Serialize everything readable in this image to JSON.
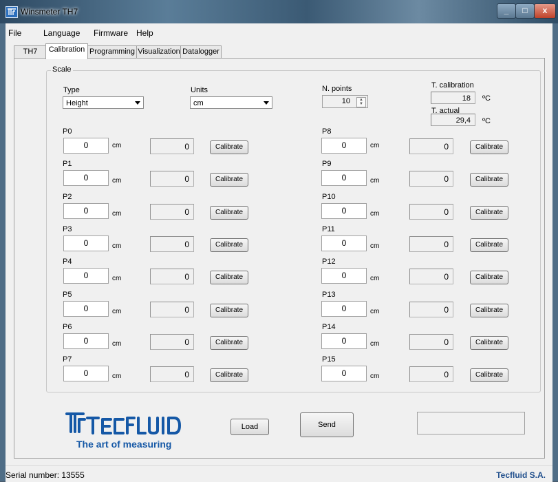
{
  "window": {
    "title": "Winsmeter TH7",
    "minimize": "_",
    "maximize": "□",
    "close": "x"
  },
  "menu": [
    "File",
    "Language",
    "Firmware",
    "Help"
  ],
  "tabs": [
    "TH7",
    "Calibration",
    "Programming",
    "Visualization",
    "Datalogger"
  ],
  "active_tab": "Calibration",
  "scale": {
    "group_label": "Scale",
    "type_label": "Type",
    "type_value": "Height",
    "units_label": "Units",
    "units_value": "cm",
    "npoints_label": "N. points",
    "npoints_value": "10",
    "tcal_label": "T. calibration",
    "tcal_value": "18",
    "tcal_unit": "ºC",
    "tact_label": "T. actual",
    "tact_value": "29,4",
    "tact_unit": "ºC"
  },
  "points": [
    {
      "label": "P0",
      "value": "0",
      "unit": "cm",
      "reading": "0",
      "button": "Calibrate"
    },
    {
      "label": "P1",
      "value": "0",
      "unit": "cm",
      "reading": "0",
      "button": "Calibrate"
    },
    {
      "label": "P2",
      "value": "0",
      "unit": "cm",
      "reading": "0",
      "button": "Calibrate"
    },
    {
      "label": "P3",
      "value": "0",
      "unit": "cm",
      "reading": "0",
      "button": "Calibrate"
    },
    {
      "label": "P4",
      "value": "0",
      "unit": "cm",
      "reading": "0",
      "button": "Calibrate"
    },
    {
      "label": "P5",
      "value": "0",
      "unit": "cm",
      "reading": "0",
      "button": "Calibrate"
    },
    {
      "label": "P6",
      "value": "0",
      "unit": "cm",
      "reading": "0",
      "button": "Calibrate"
    },
    {
      "label": "P7",
      "value": "0",
      "unit": "cm",
      "reading": "0",
      "button": "Calibrate"
    },
    {
      "label": "P8",
      "value": "0",
      "unit": "cm",
      "reading": "0",
      "button": "Calibrate"
    },
    {
      "label": "P9",
      "value": "0",
      "unit": "cm",
      "reading": "0",
      "button": "Calibrate"
    },
    {
      "label": "P10",
      "value": "0",
      "unit": "cm",
      "reading": "0",
      "button": "Calibrate"
    },
    {
      "label": "P11",
      "value": "0",
      "unit": "cm",
      "reading": "0",
      "button": "Calibrate"
    },
    {
      "label": "P12",
      "value": "0",
      "unit": "cm",
      "reading": "0",
      "button": "Calibrate"
    },
    {
      "label": "P13",
      "value": "0",
      "unit": "cm",
      "reading": "0",
      "button": "Calibrate"
    },
    {
      "label": "P14",
      "value": "0",
      "unit": "cm",
      "reading": "0",
      "button": "Calibrate"
    },
    {
      "label": "P15",
      "value": "0",
      "unit": "cm",
      "reading": "0",
      "button": "Calibrate"
    }
  ],
  "logo": {
    "brand": "TECFLUID",
    "tagline": "The art of measuring"
  },
  "buttons": {
    "load": "Load",
    "send": "Send"
  },
  "status": {
    "serial": "Serial number: 13555",
    "company": "Tecfluid S.A."
  },
  "colors": {
    "brand_blue": "#1558a6",
    "status_company": "#1f4e8c"
  }
}
